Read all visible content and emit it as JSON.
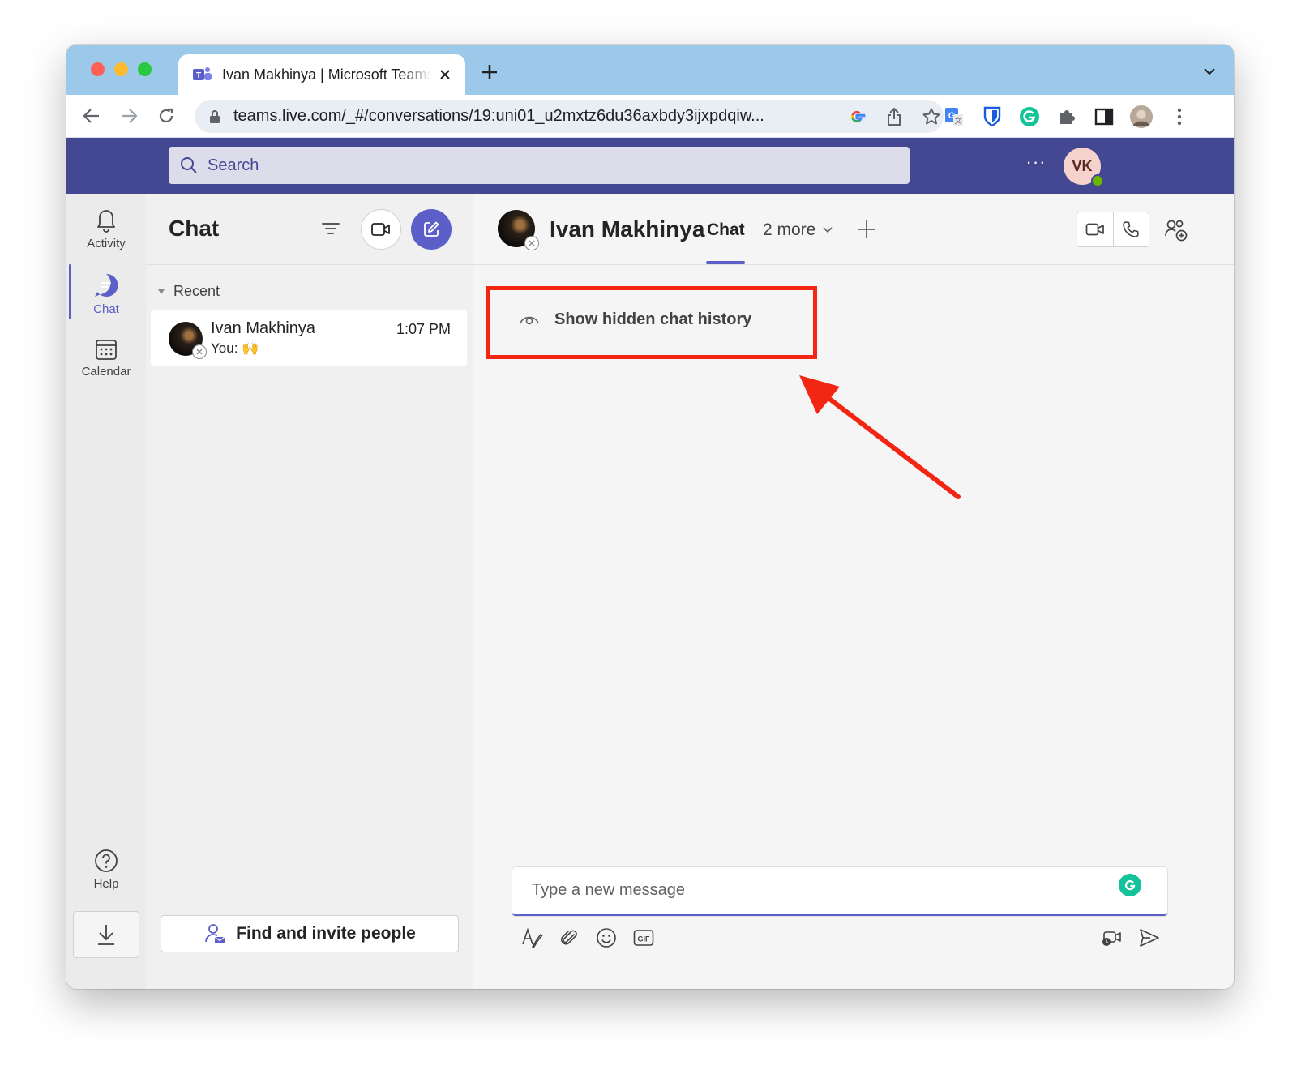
{
  "browser": {
    "tab_title": "Ivan Makhinya | Microsoft Teams",
    "url": "teams.live.com/_#/conversations/19:uni01_u2mxtz6du36axbdy3ijxpdqiw..."
  },
  "teams_header": {
    "search_placeholder": "Search",
    "more_label": "···",
    "user_initials": "VK"
  },
  "rail": {
    "items": [
      {
        "label": "Activity",
        "icon": "bell-icon"
      },
      {
        "label": "Chat",
        "icon": "chat-icon",
        "active": true
      },
      {
        "label": "Calendar",
        "icon": "calendar-icon"
      }
    ],
    "help_label": "Help"
  },
  "chat_list": {
    "title": "Chat",
    "section_label": "Recent",
    "conversations": [
      {
        "name": "Ivan Makhinya",
        "time": "1:07 PM",
        "preview": "You: 🙌"
      }
    ],
    "invite_label": "Find and invite people"
  },
  "conversation": {
    "name": "Ivan Makhinya",
    "tabs": [
      {
        "label": "Chat",
        "active": true
      }
    ],
    "more_tabs_label": "2 more",
    "hidden_history_label": "Show hidden chat history",
    "composer_placeholder": "Type a new message"
  },
  "colors": {
    "teams_purple": "#444791",
    "brand": "#5b5fc7",
    "annotation_red": "#f22613"
  }
}
